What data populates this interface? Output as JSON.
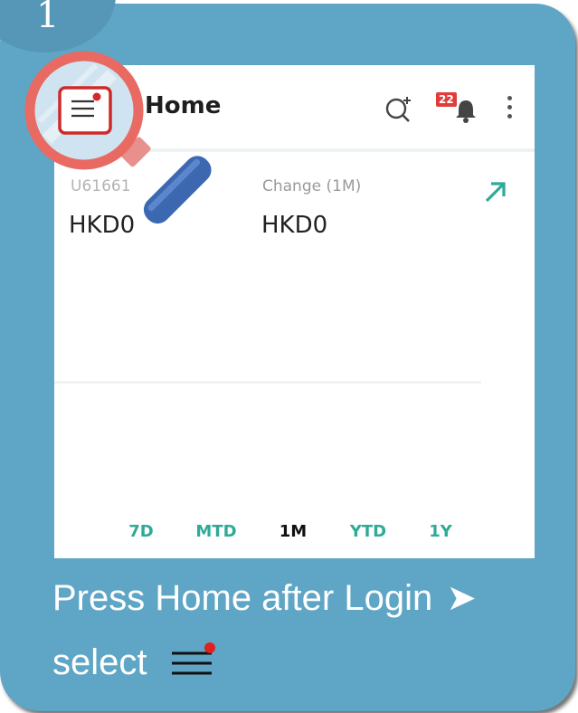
{
  "step": {
    "number": "1"
  },
  "app": {
    "title": "Home",
    "notification_count": "22"
  },
  "summary": {
    "account_label": "U61661",
    "account_value": "HKD0",
    "change_label": "Change (1M)",
    "change_value": "HKD0"
  },
  "ranges": [
    "7D",
    "MTD",
    "1M",
    "YTD",
    "1Y"
  ],
  "active_range": "1M",
  "caption": {
    "line1": "Press Home after Login",
    "line1_arrow": "➤",
    "line2": "select"
  },
  "icons": {
    "menu": "hamburger-menu-icon",
    "search_plus": "search-plus-icon",
    "bell": "bell-icon",
    "more": "more-vertical-icon",
    "expand": "expand-arrow-icon",
    "magnifier": "magnifier-icon"
  },
  "colors": {
    "card": "#5fa5c5",
    "accent_green": "#2eaa96",
    "badge_red": "#e23b3b",
    "magnifier_rim": "#e86a63",
    "handle_blue": "#3c68b1"
  }
}
